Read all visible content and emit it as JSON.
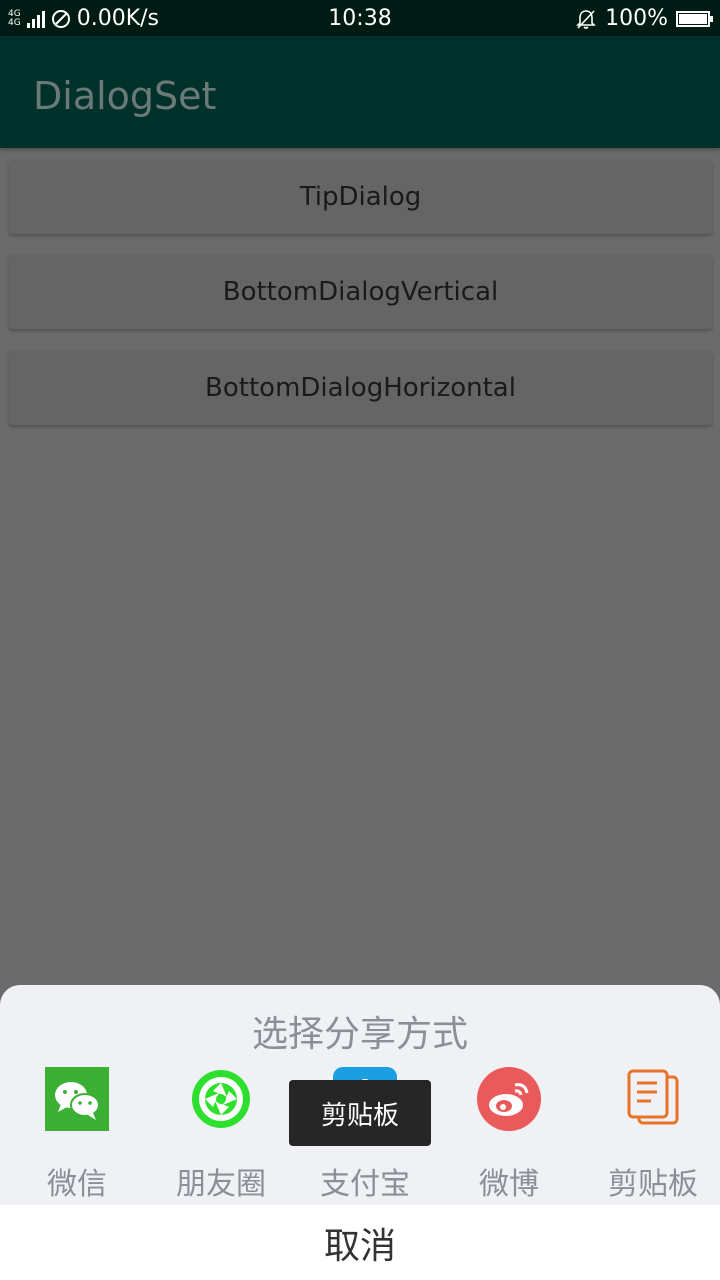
{
  "status_bar": {
    "network_type_1": "4G",
    "network_type_2": "4G",
    "speed": "0.00K/s",
    "time": "10:38",
    "battery": "100%",
    "battery_level": 1.0,
    "icons": [
      "signal-icon",
      "no-data-icon",
      "mute-bell-icon",
      "battery-icon"
    ]
  },
  "app_bar": {
    "title": "DialogSet"
  },
  "buttons": [
    {
      "label": "TipDialog"
    },
    {
      "label": "BottomDialogVertical"
    },
    {
      "label": "BottomDialogHorizontal"
    }
  ],
  "share_sheet": {
    "title": "选择分享方式",
    "items": [
      {
        "label": "微信",
        "icon": "wechat-icon",
        "color": "#3cb034"
      },
      {
        "label": "朋友圈",
        "icon": "moments-icon",
        "color": "#2ee02e"
      },
      {
        "label": "支付宝",
        "icon": "alipay-icon",
        "color": "#1a9fe0"
      },
      {
        "label": "微博",
        "icon": "weibo-icon",
        "color": "#e95a5a"
      },
      {
        "label": "剪贴板",
        "icon": "clipboard-icon",
        "color": "#e8742a"
      }
    ],
    "cancel_label": "取消"
  },
  "toast": {
    "text": "剪贴板"
  },
  "colors": {
    "status_bar_bg": "#001a14",
    "app_bar_bg": "#00312a",
    "scrim_bg": "#6b6b6b",
    "sheet_bg": "#f0f1f5"
  }
}
